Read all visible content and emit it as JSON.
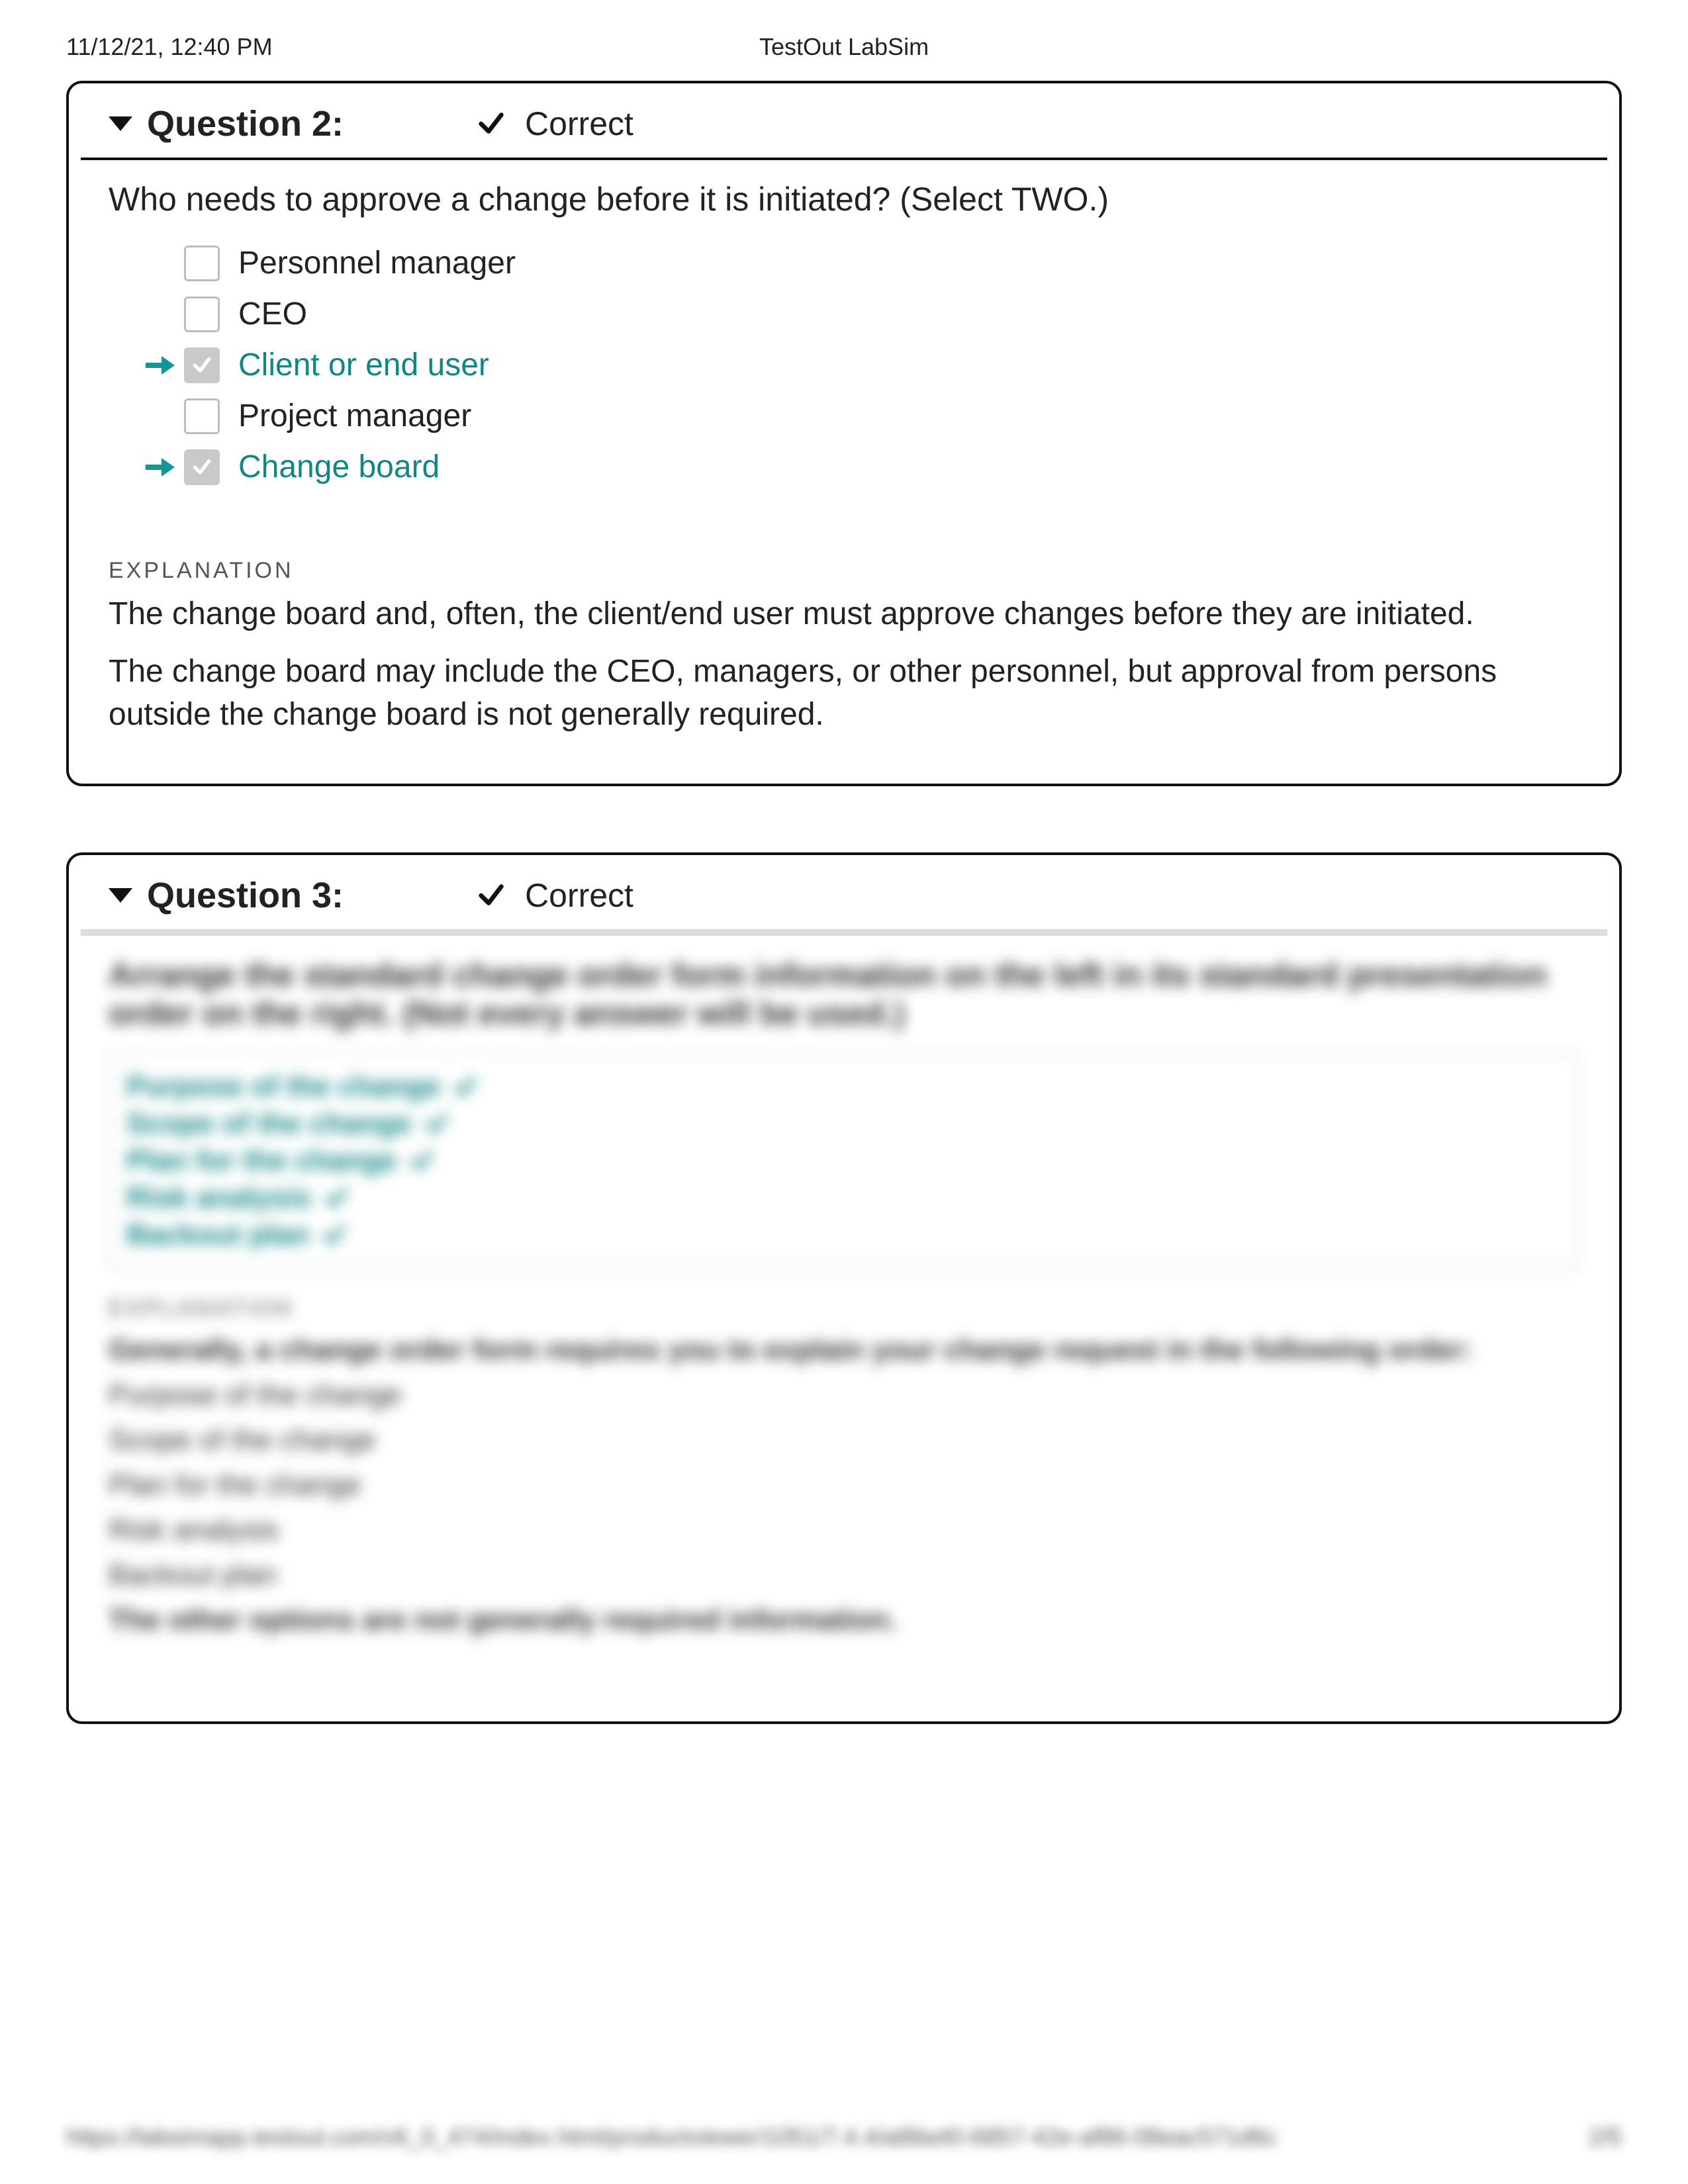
{
  "header": {
    "datetime": "11/12/21, 12:40 PM",
    "title": "TestOut LabSim"
  },
  "q2": {
    "title": "Question 2:",
    "status": "Correct",
    "prompt": "Who needs to approve a change before it is initiated? (Select TWO.)",
    "answers": [
      {
        "label": "Personnel manager",
        "correct": false
      },
      {
        "label": "CEO",
        "correct": false
      },
      {
        "label": "Client or end user",
        "correct": true
      },
      {
        "label": "Project manager",
        "correct": false
      },
      {
        "label": "Change board",
        "correct": true
      }
    ],
    "explanation_head": "EXPLANATION",
    "explanation": [
      "The change board and, often, the client/end user must approve changes before they are initiated.",
      "The change board may include the CEO, managers, or other personnel, but approval from persons outside the change board is not generally required."
    ]
  },
  "q3": {
    "title": "Question 3:",
    "status": "Correct",
    "prompt": "Arrange the standard change order form information on the left in its standard presentation order on the right. (Not every answer will be used.)",
    "ordered_answers": [
      "Purpose of the change",
      "Scope of the change",
      "Plan for the change",
      "Risk analysis",
      "Backout plan"
    ],
    "explanation_head": "EXPLANATION",
    "explanation": [
      "Generally, a change order form requires you to explain your change request in the following order:",
      "Purpose of the change",
      "Scope of the change",
      "Plan for the change",
      "Risk analysis",
      "Backout plan",
      "The other options are not generally required information."
    ]
  },
  "footer": {
    "left": "https://labsimapp.testout.com/v6_0_474/index.html/productviewer/1051/7.4.4/a88a40-6857-42e-af86-08eac571d6c",
    "right": "2/5"
  }
}
